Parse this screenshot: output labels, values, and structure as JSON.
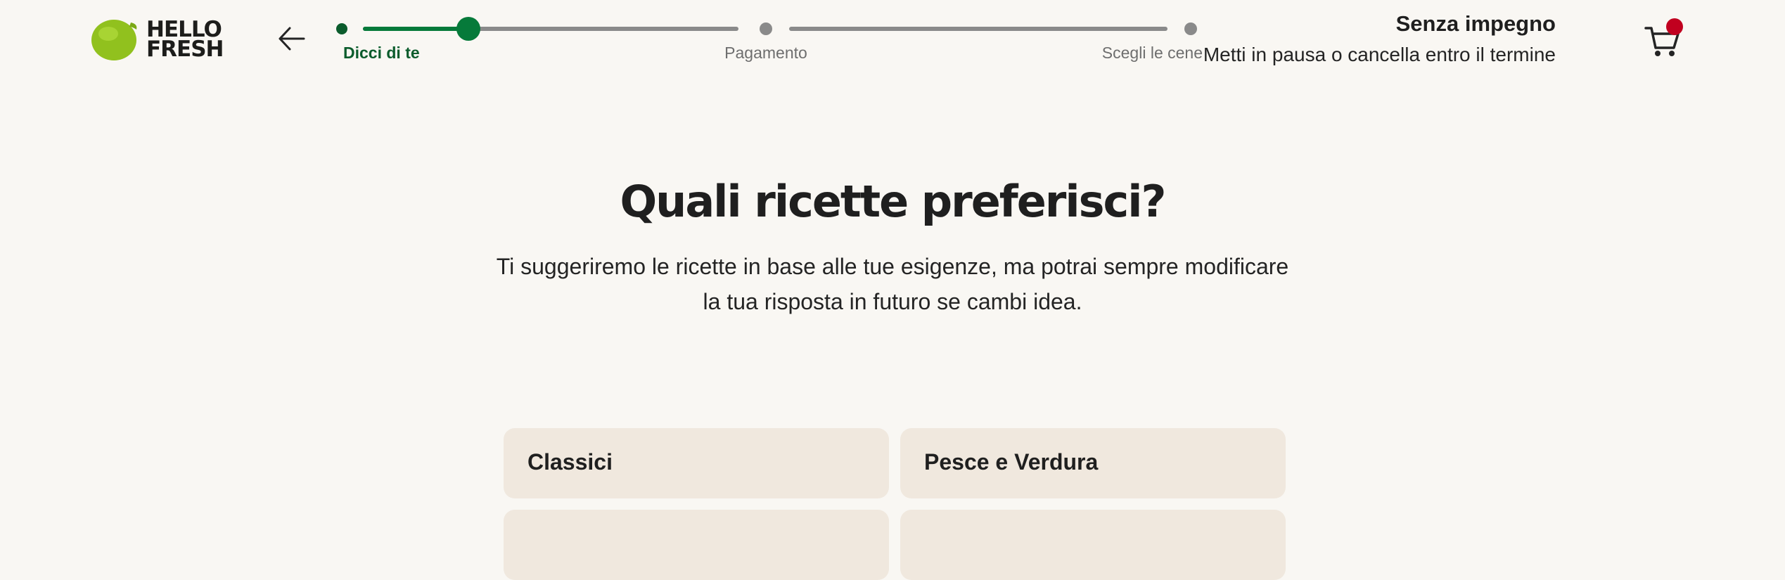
{
  "brand": {
    "logo_line1": "HELLO",
    "logo_line2": "FRESH",
    "accent": "#067a3a",
    "lime": "#91c11e"
  },
  "header": {
    "back_icon": "arrow-left-icon",
    "steps": [
      {
        "label": "Dicci di te",
        "state": "active"
      },
      {
        "label": "Pagamento",
        "state": "upcoming"
      },
      {
        "label": "Scegli le cene",
        "state": "upcoming"
      }
    ],
    "current_step_progress": 0.28,
    "promo_title": "Senza impegno",
    "promo_subtitle": "Metti in pausa o cancella entro il termine",
    "cart_icon": "cart-icon",
    "cart_badge_color": "#c1001f"
  },
  "main": {
    "title": "Quali ricette preferisci?",
    "description_line1": "Ti suggeriremo le ricette in base alle tue esigenze, ma potrai sempre modificare",
    "description_line2": "la tua risposta in futuro se cambi idea.",
    "options": [
      {
        "label": "Classici"
      },
      {
        "label": "Pesce e Verdura"
      },
      {
        "label": ""
      },
      {
        "label": ""
      }
    ]
  }
}
